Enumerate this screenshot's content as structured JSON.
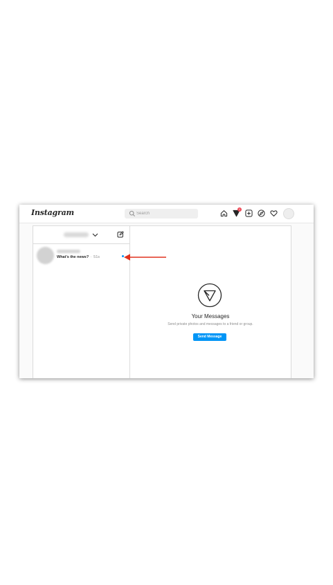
{
  "app": {
    "logo_text": "Instagram"
  },
  "search": {
    "placeholder": "Search"
  },
  "nav": {
    "icons": [
      "home-icon",
      "direct-send-icon",
      "new-post-icon",
      "explore-compass-icon",
      "activity-heart-icon",
      "profile-avatar"
    ],
    "direct_badge_count": "1"
  },
  "inbox": {
    "account_name_blurred": "",
    "threads": [
      {
        "name_blurred": "",
        "last_message": "What's the news?",
        "separator": "·",
        "time": "51s",
        "unread": true
      }
    ]
  },
  "empty_state": {
    "title": "Your Messages",
    "subtitle": "Send private photos and messages to a friend or group.",
    "button_label": "Send Message"
  },
  "annotation": {
    "arrow_color": "#e0321e"
  },
  "colors": {
    "accent": "#0095f6",
    "badge": "#ed4956",
    "border": "#dbdbdb"
  }
}
